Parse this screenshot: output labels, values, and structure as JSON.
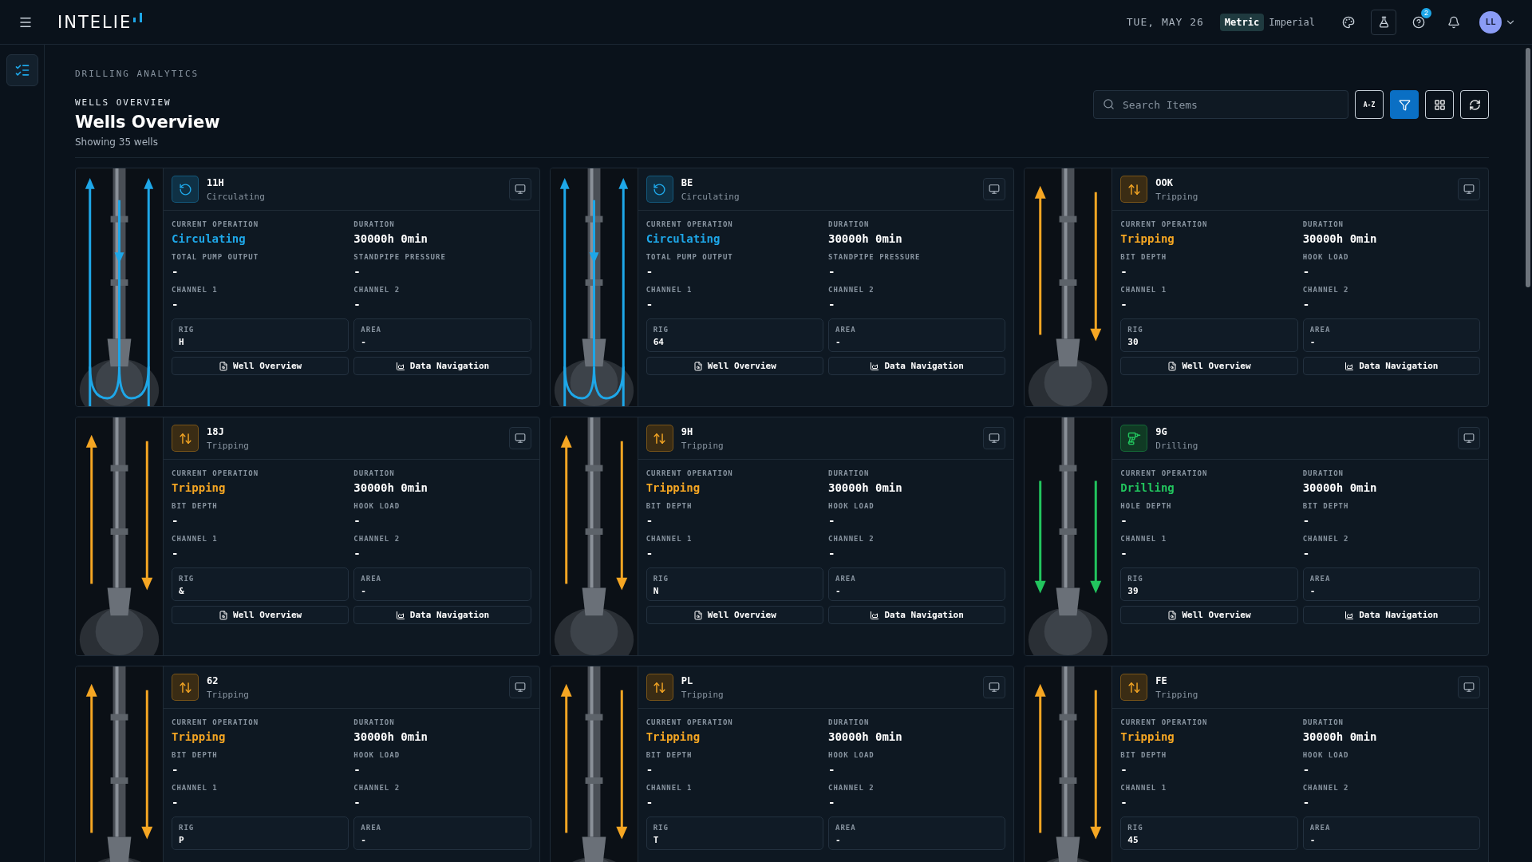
{
  "topbar": {
    "logo": "INTELIE",
    "date": "TUE, MAY 26",
    "units": [
      {
        "label": "Metric",
        "selected": true
      },
      {
        "label": "Imperial",
        "selected": false
      }
    ],
    "help_badge": "2",
    "avatar": "LL"
  },
  "header": {
    "breadcrumb": "DRILLING ANALYTICS",
    "section": "WELLS OVERVIEW",
    "title": "Wells Overview",
    "subtitle": "Showing 35 wells"
  },
  "toolbar": {
    "search_placeholder": "Search Items",
    "sort_label": "A-Z",
    "filter_active": true
  },
  "wells": [
    {
      "name": "11H",
      "status": "Circulating",
      "kind": "circulating",
      "operation": "Circulating",
      "duration_label": "DURATION",
      "duration": "30000h 0min",
      "metrics": [
        {
          "label": "CURRENT OPERATION"
        },
        {
          "label": "TOTAL PUMP OUTPUT",
          "value": "-"
        },
        {
          "label": "STANDPIPE PRESSURE",
          "value": "-"
        },
        {
          "label": "CHANNEL 1",
          "value": "-"
        },
        {
          "label": "CHANNEL 2",
          "value": "-"
        }
      ],
      "rig_label": "RIG",
      "rig": "H",
      "area_label": "AREA",
      "area": "-",
      "actions": [
        "Well Overview",
        "Data Navigation"
      ]
    },
    {
      "name": "BE",
      "status": "Circulating",
      "kind": "circulating",
      "operation": "Circulating",
      "duration_label": "DURATION",
      "duration": "30000h 0min",
      "metrics": [
        {
          "label": "CURRENT OPERATION"
        },
        {
          "label": "TOTAL PUMP OUTPUT",
          "value": "-"
        },
        {
          "label": "STANDPIPE PRESSURE",
          "value": "-"
        },
        {
          "label": "CHANNEL 1",
          "value": "-"
        },
        {
          "label": "CHANNEL 2",
          "value": "-"
        }
      ],
      "rig_label": "RIG",
      "rig": "64",
      "area_label": "AREA",
      "area": "-",
      "actions": [
        "Well Overview",
        "Data Navigation"
      ]
    },
    {
      "name": "OOK",
      "status": "Tripping",
      "kind": "tripping",
      "operation": "Tripping",
      "duration_label": "DURATION",
      "duration": "30000h 0min",
      "metrics": [
        {
          "label": "CURRENT OPERATION"
        },
        {
          "label": "BIT DEPTH",
          "value": "-"
        },
        {
          "label": "HOOK LOAD",
          "value": "-"
        },
        {
          "label": "CHANNEL 1",
          "value": "-"
        },
        {
          "label": "CHANNEL 2",
          "value": "-"
        }
      ],
      "rig_label": "RIG",
      "rig": "30",
      "area_label": "AREA",
      "area": "-",
      "actions": [
        "Well Overview",
        "Data Navigation"
      ]
    },
    {
      "name": "18J",
      "status": "Tripping",
      "kind": "tripping",
      "operation": "Tripping",
      "duration_label": "DURATION",
      "duration": "30000h 0min",
      "metrics": [
        {
          "label": "CURRENT OPERATION"
        },
        {
          "label": "BIT DEPTH",
          "value": "-"
        },
        {
          "label": "HOOK LOAD",
          "value": "-"
        },
        {
          "label": "CHANNEL 1",
          "value": "-"
        },
        {
          "label": "CHANNEL 2",
          "value": "-"
        }
      ],
      "rig_label": "RIG",
      "rig": "&",
      "area_label": "AREA",
      "area": "-",
      "actions": [
        "Well Overview",
        "Data Navigation"
      ]
    },
    {
      "name": "9H",
      "status": "Tripping",
      "kind": "tripping",
      "operation": "Tripping",
      "duration_label": "DURATION",
      "duration": "30000h 0min",
      "metrics": [
        {
          "label": "CURRENT OPERATION"
        },
        {
          "label": "BIT DEPTH",
          "value": "-"
        },
        {
          "label": "HOOK LOAD",
          "value": "-"
        },
        {
          "label": "CHANNEL 1",
          "value": "-"
        },
        {
          "label": "CHANNEL 2",
          "value": "-"
        }
      ],
      "rig_label": "RIG",
      "rig": "N",
      "area_label": "AREA",
      "area": "-",
      "actions": [
        "Well Overview",
        "Data Navigation"
      ]
    },
    {
      "name": "9G",
      "status": "Drilling",
      "kind": "drilling",
      "operation": "Drilling",
      "duration_label": "DURATION",
      "duration": "30000h 0min",
      "metrics": [
        {
          "label": "CURRENT OPERATION"
        },
        {
          "label": "HOLE DEPTH",
          "value": "-"
        },
        {
          "label": "BIT DEPTH",
          "value": "-"
        },
        {
          "label": "CHANNEL 1",
          "value": "-"
        },
        {
          "label": "CHANNEL 2",
          "value": "-"
        }
      ],
      "rig_label": "RIG",
      "rig": "39",
      "area_label": "AREA",
      "area": "-",
      "actions": [
        "Well Overview",
        "Data Navigation"
      ]
    },
    {
      "name": "62",
      "status": "Tripping",
      "kind": "tripping",
      "operation": "Tripping",
      "duration_label": "DURATION",
      "duration": "30000h 0min",
      "metrics": [
        {
          "label": "CURRENT OPERATION"
        },
        {
          "label": "BIT DEPTH",
          "value": "-"
        },
        {
          "label": "HOOK LOAD",
          "value": "-"
        },
        {
          "label": "CHANNEL 1",
          "value": "-"
        },
        {
          "label": "CHANNEL 2",
          "value": "-"
        }
      ],
      "rig_label": "RIG",
      "rig": "P",
      "area_label": "AREA",
      "area": "-"
    },
    {
      "name": "PL",
      "status": "Tripping",
      "kind": "tripping",
      "operation": "Tripping",
      "duration_label": "DURATION",
      "duration": "30000h 0min",
      "metrics": [
        {
          "label": "CURRENT OPERATION"
        },
        {
          "label": "BIT DEPTH",
          "value": "-"
        },
        {
          "label": "HOOK LOAD",
          "value": "-"
        },
        {
          "label": "CHANNEL 1",
          "value": "-"
        },
        {
          "label": "CHANNEL 2",
          "value": "-"
        }
      ],
      "rig_label": "RIG",
      "rig": "T",
      "area_label": "AREA",
      "area": "-"
    },
    {
      "name": "FE",
      "status": "Tripping",
      "kind": "tripping",
      "operation": "Tripping",
      "duration_label": "DURATION",
      "duration": "30000h 0min",
      "metrics": [
        {
          "label": "CURRENT OPERATION"
        },
        {
          "label": "BIT DEPTH",
          "value": "-"
        },
        {
          "label": "HOOK LOAD",
          "value": "-"
        },
        {
          "label": "CHANNEL 1",
          "value": "-"
        },
        {
          "label": "CHANNEL 2",
          "value": "-"
        }
      ],
      "rig_label": "RIG",
      "rig": "45",
      "area_label": "AREA",
      "area": "-"
    }
  ]
}
